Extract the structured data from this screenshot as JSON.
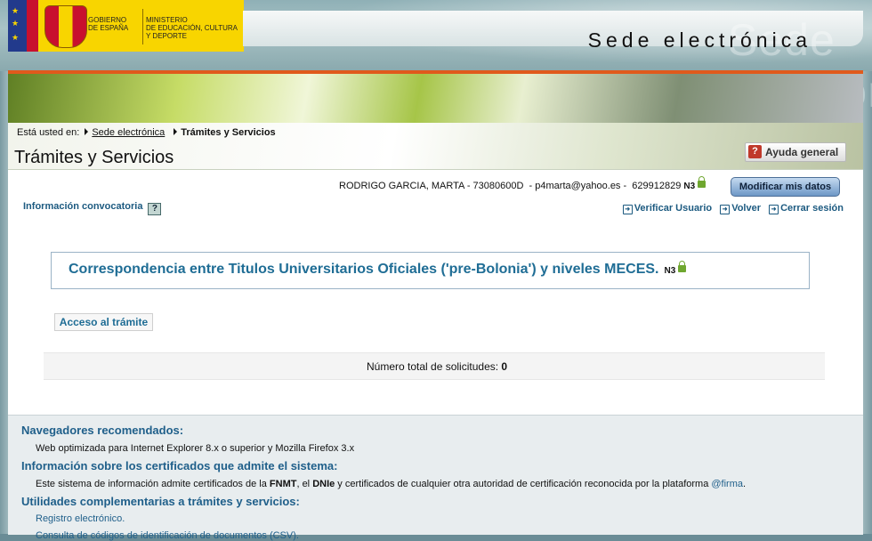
{
  "header": {
    "gov_line1": "Gobierno",
    "gov_line2": "de España",
    "min_line1": "Ministerio",
    "min_line2": "de Educación, Cultura",
    "min_line3": "y Deporte",
    "site_title": "Sede electrónica",
    "site_title_bg": "Sede electrónica"
  },
  "breadcrumb": {
    "prefix": "Está usted en:",
    "items": [
      "Sede electrónica",
      "Trámites y Servicios"
    ]
  },
  "page_title": "Trámites y Servicios",
  "help_button": "Ayuda general",
  "user": {
    "info": "RODRIGO GARCIA, MARTA - 73080600D  - p4marta@yahoo.es -  629912829",
    "level": "N3",
    "modify_button": "Modificar mis datos"
  },
  "info_convocatoria": "Información convocatoria",
  "help_icon_glyph": "?",
  "actions": [
    "Verificar Usuario",
    "Volver",
    "Cerrar sesión"
  ],
  "procedure": {
    "title": "Correspondencia entre Titulos Universitarios Oficiales ('pre-Bolonia') y niveles MECES.",
    "level": "N3",
    "access_button": "Acceso al trámite"
  },
  "total": {
    "label": "Número total de solicitudes:",
    "value": "0"
  },
  "footer": {
    "browsers_heading": "Navegadores recomendados:",
    "browsers_text": "Web optimizada para Internet Explorer 8.x o superior y Mozilla Firefox 3.x",
    "certs_heading": "Información sobre los certificados que admite el sistema:",
    "certs_text_1": "Este sistema de información admite certificados de la ",
    "certs_fnmt": "FNMT",
    "certs_text_2": ", el ",
    "certs_dnie": "DNIe",
    "certs_text_3": " y certificados de cualquier otra autoridad de certificación reconocida por la plataforma ",
    "certs_firma": "@firma",
    "certs_text_4": ".",
    "utils_heading": "Utilidades complementarias a trámites y servicios:",
    "utils_items": [
      "Registro electrónico.",
      "Consulta de códigos de identificación de documentos (CSV)."
    ]
  },
  "colors": {
    "accent_orange": "#e05a1c",
    "link_blue": "#1f6d95",
    "button_blue": "#6d97c6",
    "lock_green": "#6fa72f"
  }
}
